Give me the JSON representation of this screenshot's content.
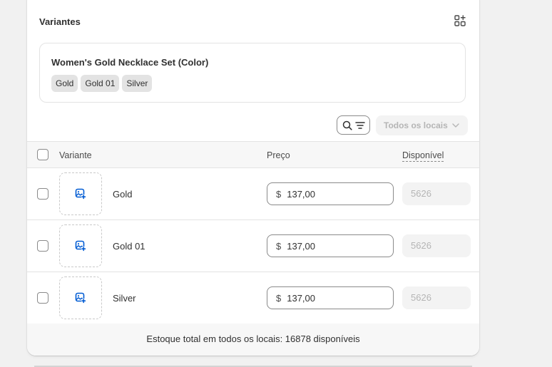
{
  "card": {
    "title": "Variantes"
  },
  "option": {
    "name": "Women's Gold Necklace Set (Color)",
    "values": [
      "Gold",
      "Gold 01",
      "Silver"
    ]
  },
  "toolbar": {
    "location_select": "Todos os locais"
  },
  "table": {
    "headers": {
      "variant": "Variante",
      "price": "Preço",
      "available": "Disponível"
    },
    "rows": [
      {
        "name": "Gold",
        "currency": "$",
        "price": "137,00",
        "available": "5626"
      },
      {
        "name": "Gold 01",
        "currency": "$",
        "price": "137,00",
        "available": "5626"
      },
      {
        "name": "Silver",
        "currency": "$",
        "price": "137,00",
        "available": "5626"
      }
    ]
  },
  "footer": {
    "total_text": "Estoque total em todos os locais: 16878 disponíveis"
  },
  "icons": {
    "grid": "grid-plus-icon",
    "search": "search-icon",
    "filter": "filter-icon",
    "chevron": "chevron-down-icon",
    "image_add": "image-add-icon"
  },
  "colors": {
    "accent": "#005bd3",
    "border": "#8a8a8a",
    "muted": "#b5b5b5"
  }
}
